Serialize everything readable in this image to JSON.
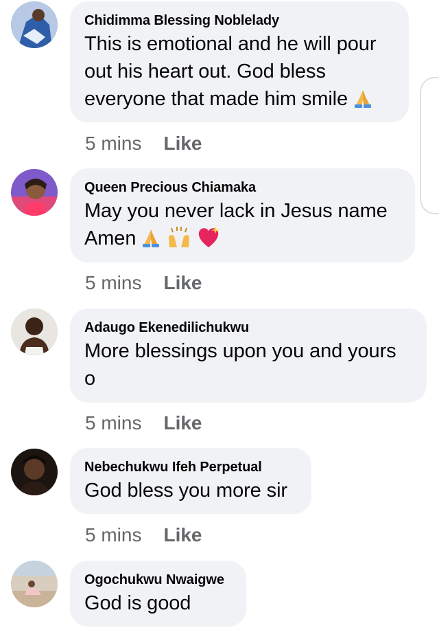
{
  "comments": [
    {
      "author": "Chidimma Blessing Noblelady",
      "lines": [
        "This is emotional and he will pour",
        "out his heart out. God bless",
        "everyone that made him smile"
      ],
      "emoji": [
        "folded-hands"
      ],
      "time": "5 mins",
      "like": "Like"
    },
    {
      "author": "Queen Precious Chiamaka",
      "lines": [
        "May you never lack in Jesus name",
        "Amen"
      ],
      "emoji": [
        "folded-hands",
        "raising-hands",
        "sparkling-heart"
      ],
      "time": "5 mins",
      "like": "Like"
    },
    {
      "author": "Adaugo Ekenedilichukwu",
      "lines": [
        "More blessings upon you and yours",
        "o"
      ],
      "emoji": [],
      "time": "5 mins",
      "like": "Like"
    },
    {
      "author": "Nebechukwu Ifeh Perpetual",
      "lines": [
        "God bless you more sir"
      ],
      "emoji": [],
      "time": "5 mins",
      "like": "Like"
    },
    {
      "author": "Ogochukwu Nwaigwe",
      "lines": [
        "God is good"
      ],
      "emoji": [],
      "time": "",
      "like": ""
    }
  ],
  "colors": {
    "bubble": "#f0f2f5",
    "meta_text": "#65676b",
    "primary_text": "#050505"
  }
}
